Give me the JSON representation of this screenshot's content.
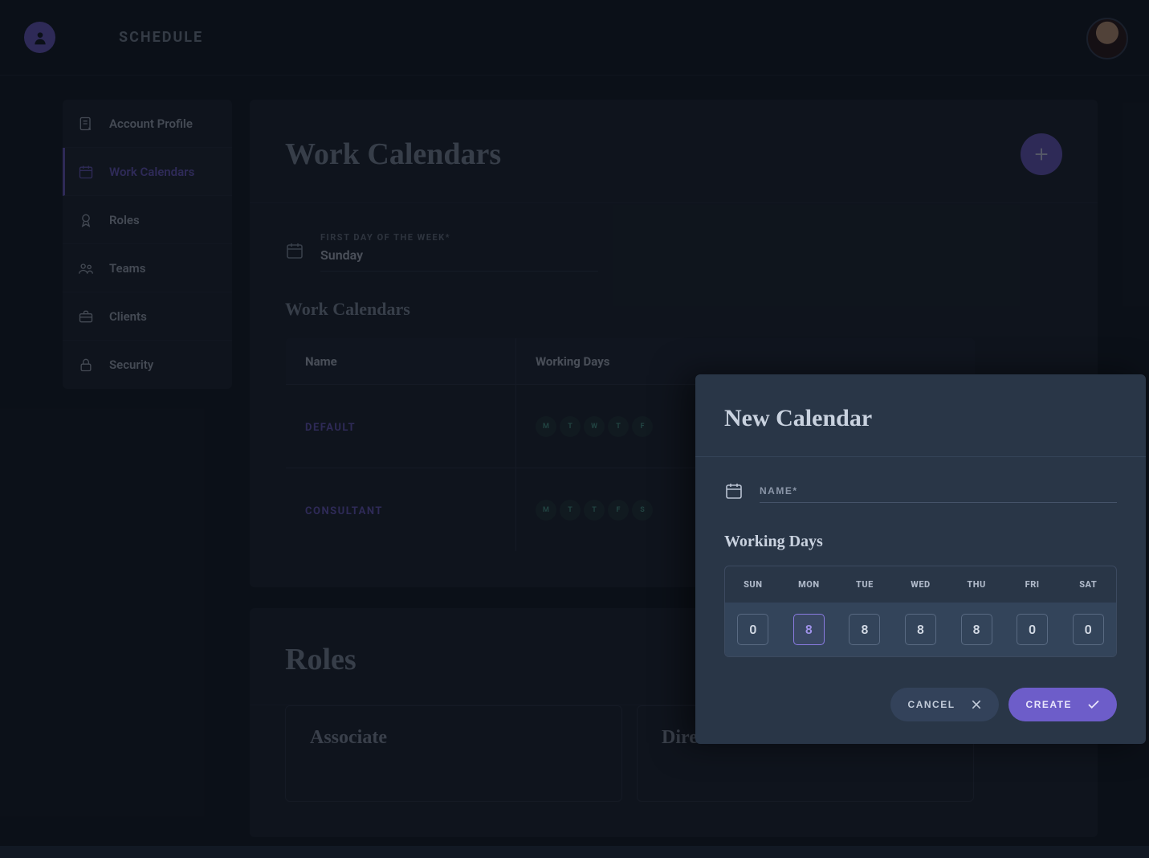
{
  "app": {
    "title": "SCHEDULE"
  },
  "sidebar": {
    "items": [
      {
        "label": "Account Profile",
        "name": "sidebar-item-account-profile",
        "icon": "profile-note-icon"
      },
      {
        "label": "Work Calendars",
        "name": "sidebar-item-work-calendars",
        "icon": "calendar-icon",
        "active": true
      },
      {
        "label": "Roles",
        "name": "sidebar-item-roles",
        "icon": "badge-icon"
      },
      {
        "label": "Teams",
        "name": "sidebar-item-teams",
        "icon": "people-icon"
      },
      {
        "label": "Clients",
        "name": "sidebar-item-clients",
        "icon": "briefcase-icon"
      },
      {
        "label": "Security",
        "name": "sidebar-item-security",
        "icon": "lock-icon"
      }
    ]
  },
  "work_calendars": {
    "title": "Work Calendars",
    "first_day_label": "FIRST DAY OF THE WEEK*",
    "first_day_value": "Sunday",
    "subheading": "Work Calendars",
    "columns": {
      "name": "Name",
      "days": "Working Days"
    },
    "rows": [
      {
        "name": "DEFAULT",
        "days": [
          "M",
          "T",
          "W",
          "T",
          "F"
        ]
      },
      {
        "name": "CONSULTANT",
        "days": [
          "M",
          "T",
          "T",
          "F",
          "S"
        ]
      }
    ]
  },
  "roles": {
    "title": "Roles",
    "cards": [
      {
        "title": "Associate"
      },
      {
        "title": "Direc"
      }
    ]
  },
  "drawer": {
    "title": "New Calendar",
    "name_placeholder": "NAME*",
    "working_days_title": "Working Days",
    "day_headers": [
      "SUN",
      "MON",
      "TUE",
      "WED",
      "THU",
      "FRI",
      "SAT"
    ],
    "day_values": [
      "0",
      "8",
      "8",
      "8",
      "8",
      "0",
      "0"
    ],
    "selected_index": 1,
    "cancel_label": "CANCEL",
    "create_label": "CREATE"
  }
}
